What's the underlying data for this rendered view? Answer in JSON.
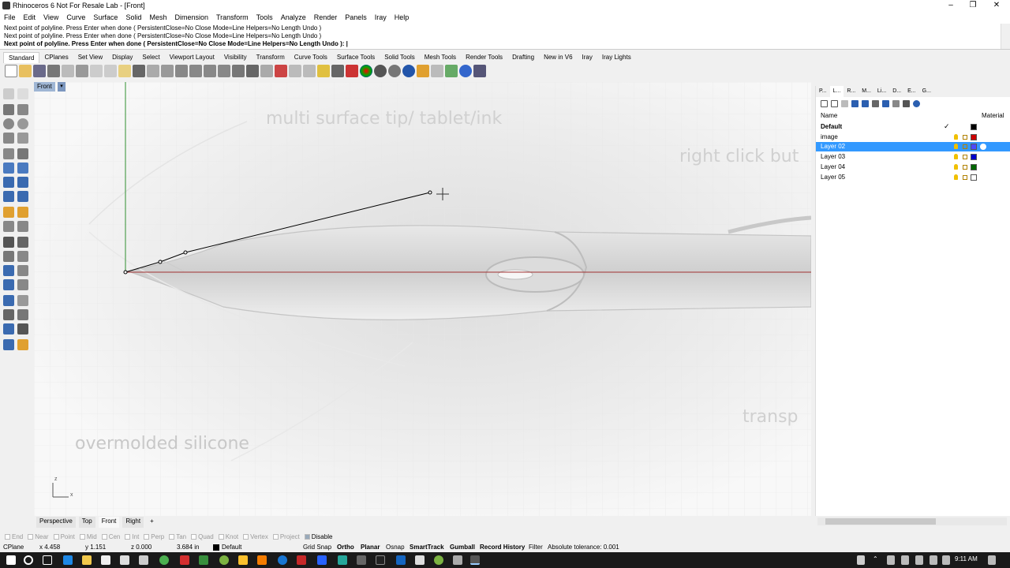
{
  "window": {
    "title": "Rhinoceros 6 Not For Resale Lab - [Front]",
    "minimize": "–",
    "maximize": "❐",
    "close": "✕"
  },
  "menu": [
    "File",
    "Edit",
    "View",
    "Curve",
    "Surface",
    "Solid",
    "Mesh",
    "Dimension",
    "Transform",
    "Tools",
    "Analyze",
    "Render",
    "Panels",
    "Iray",
    "Help"
  ],
  "command_history": [
    "Next point of polyline. Press Enter when done ( PersistentClose=No  Close  Mode=Line  Helpers=No  Length  Undo )",
    "Next point of polyline. Press Enter when done ( PersistentClose=No  Close  Mode=Line  Helpers=No  Length  Undo )"
  ],
  "command_prompt": "Next point of polyline. Press Enter when done ( PersistentClose=No  Close  Mode=Line  Helpers=No  Length  Undo ):",
  "toolbar_tabs": [
    "Standard",
    "CPlanes",
    "Set View",
    "Display",
    "Select",
    "Viewport Layout",
    "Visibility",
    "Transform",
    "Curve Tools",
    "Surface Tools",
    "Solid Tools",
    "Mesh Tools",
    "Render Tools",
    "Drafting",
    "New in V6",
    "Iray",
    "Iray Lights"
  ],
  "viewport": {
    "name": "Front",
    "dropdown_arrow": "▾",
    "sketch_texts": [
      "multi surface tip/ tablet/ink",
      "right click but",
      "overmolded silicone",
      "transp"
    ],
    "axis_z": "z",
    "axis_x": "x"
  },
  "panel": {
    "tabs": [
      "P...",
      "L...",
      "R...",
      "M...",
      "Li...",
      "D...",
      "E...",
      "G..."
    ],
    "columns": {
      "name": "Name",
      "material": "Material",
      "current_mark": "✓"
    },
    "layers": [
      {
        "name": "Default",
        "color": "#000000",
        "current": true
      },
      {
        "name": "image",
        "color": "#cc0000"
      },
      {
        "name": "Layer 02",
        "color": "#4a4aff",
        "selected": true
      },
      {
        "name": "Layer 03",
        "color": "#0000cc"
      },
      {
        "name": "Layer 04",
        "color": "#006600"
      },
      {
        "name": "Layer 05",
        "color": "#ffffff"
      }
    ]
  },
  "view_tabs": [
    "Perspective",
    "Top",
    "Front",
    "Right"
  ],
  "view_tab_add": "+",
  "active_view": "Front",
  "osnaps": [
    "End",
    "Near",
    "Point",
    "Mid",
    "Cen",
    "Int",
    "Perp",
    "Tan",
    "Quad",
    "Knot",
    "Vertex",
    "Project",
    "Disable"
  ],
  "status": {
    "cplane": "CPlane",
    "x": "x 4.458",
    "y": "y 1.151",
    "z": "z 0.000",
    "distance": "3.684 in",
    "layer": "Default",
    "grid_snap": "Grid Snap",
    "ortho": "Ortho",
    "planar": "Planar",
    "osnap": "Osnap",
    "smarttrack": "SmartTrack",
    "gumball": "Gumball",
    "record_history": "Record History",
    "filter": "Filter",
    "tolerance": "Absolute tolerance: 0.001"
  },
  "taskbar": {
    "time": "9:11 AM"
  }
}
